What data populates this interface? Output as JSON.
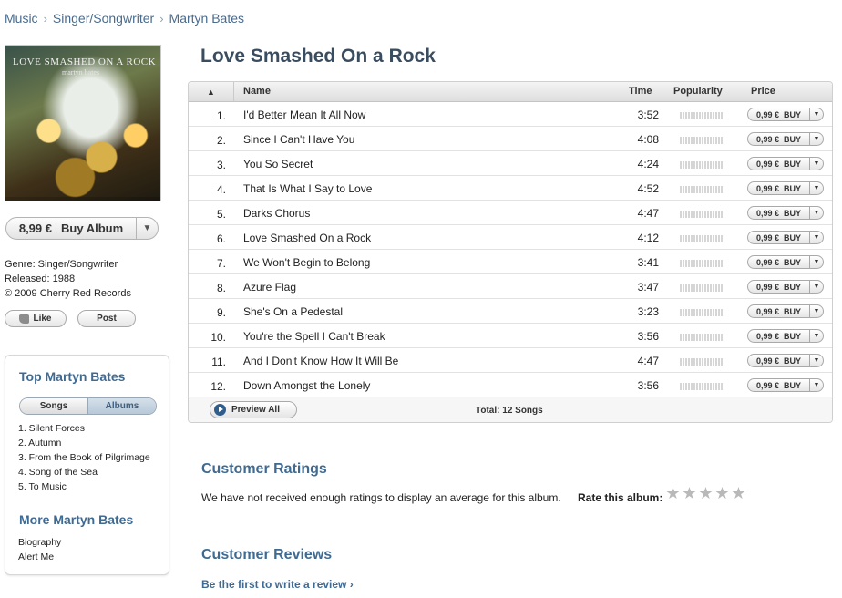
{
  "breadcrumb": [
    "Music",
    "Singer/Songwriter",
    "Martyn Bates"
  ],
  "album": {
    "title": "Love Smashed On a Rock",
    "art_title": "LOVE SMASHED ON A ROCK",
    "art_artist": "martyn bates",
    "price": "8,99 €",
    "buy_label": "Buy Album",
    "genre": "Genre: Singer/Songwriter",
    "released": "Released: 1988",
    "copyright": "© 2009 Cherry Red Records",
    "like_label": "Like",
    "post_label": "Post"
  },
  "top": {
    "heading": "Top Martyn Bates",
    "tab_songs": "Songs",
    "tab_albums": "Albums",
    "songs": [
      "1. Silent Forces",
      "2. Autumn",
      "3. From the Book of Pilgrimage",
      "4. Song of the Sea",
      "5. To Music"
    ]
  },
  "more": {
    "heading": "More Martyn Bates",
    "links": [
      "Biography",
      "Alert Me"
    ]
  },
  "table": {
    "sort_indicator": "▲",
    "col_name": "Name",
    "col_time": "Time",
    "col_popularity": "Popularity",
    "col_price": "Price",
    "price_label": "0,99 €",
    "buy_label": "BUY",
    "preview_label": "Preview All",
    "total": "Total: 12 Songs",
    "rows": [
      {
        "num": "1.",
        "name": "I'd Better Mean It All Now",
        "time": "3:52"
      },
      {
        "num": "2.",
        "name": "Since I Can't Have You",
        "time": "4:08"
      },
      {
        "num": "3.",
        "name": "You So Secret",
        "time": "4:24"
      },
      {
        "num": "4.",
        "name": "That Is What I Say to Love",
        "time": "4:52"
      },
      {
        "num": "5.",
        "name": "Darks Chorus",
        "time": "4:47"
      },
      {
        "num": "6.",
        "name": "Love Smashed On a Rock",
        "time": "4:12"
      },
      {
        "num": "7.",
        "name": "We Won't Begin to Belong",
        "time": "3:41"
      },
      {
        "num": "8.",
        "name": "Azure Flag",
        "time": "3:47"
      },
      {
        "num": "9.",
        "name": "She's On a Pedestal",
        "time": "3:23"
      },
      {
        "num": "10.",
        "name": "You're the Spell I Can't Break",
        "time": "3:56"
      },
      {
        "num": "11.",
        "name": "And I Don't Know How It Will Be",
        "time": "4:47"
      },
      {
        "num": "12.",
        "name": "Down Amongst the Lonely",
        "time": "3:56"
      }
    ]
  },
  "ratings": {
    "heading": "Customer Ratings",
    "text": "We have not received enough ratings to display an average for this album.",
    "rate_label": "Rate this album:"
  },
  "reviews": {
    "heading": "Customer Reviews",
    "link": "Be the first to write a review ›"
  },
  "colors": {
    "link_blue": "#3f6a92",
    "title_slate": "#3a4d60"
  }
}
